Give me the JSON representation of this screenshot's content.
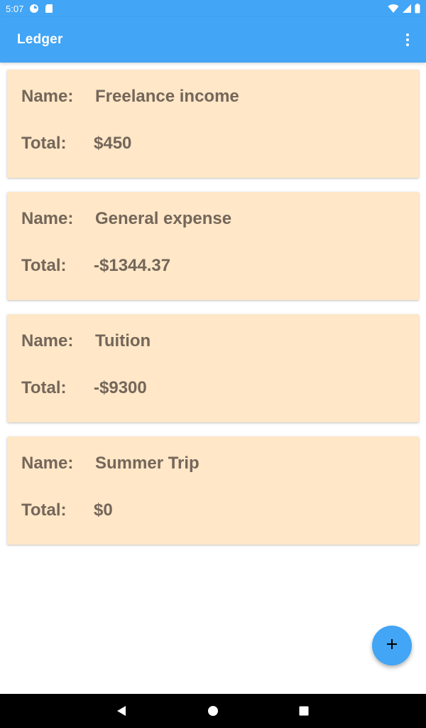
{
  "status_bar": {
    "time": "5:07",
    "icons_left": [
      "data-saver-icon",
      "sd-card-icon"
    ],
    "icons_right": [
      "wifi-icon",
      "signal-icon",
      "battery-icon"
    ]
  },
  "app_bar": {
    "title": "Ledger",
    "overflow_icon": "more-vert-icon"
  },
  "ledgers": [
    {
      "name_label": "Name:",
      "name": "Freelance income",
      "total_label": "Total:",
      "total": "$450"
    },
    {
      "name_label": "Name:",
      "name": "General expense",
      "total_label": "Total:",
      "total": "-$1344.37"
    },
    {
      "name_label": "Name:",
      "name": "Tuition",
      "total_label": "Total:",
      "total": "-$9300"
    },
    {
      "name_label": "Name:",
      "name": "Summer Trip",
      "total_label": "Total:",
      "total": "$0"
    }
  ],
  "fab": {
    "icon": "add-icon"
  },
  "nav_bar": {
    "buttons": [
      "back-icon",
      "home-icon",
      "recents-icon"
    ]
  },
  "colors": {
    "primary": "#42a5f5",
    "card_background": "#ffe7c7",
    "card_text": "#74665a",
    "nav_bar": "#000000"
  }
}
